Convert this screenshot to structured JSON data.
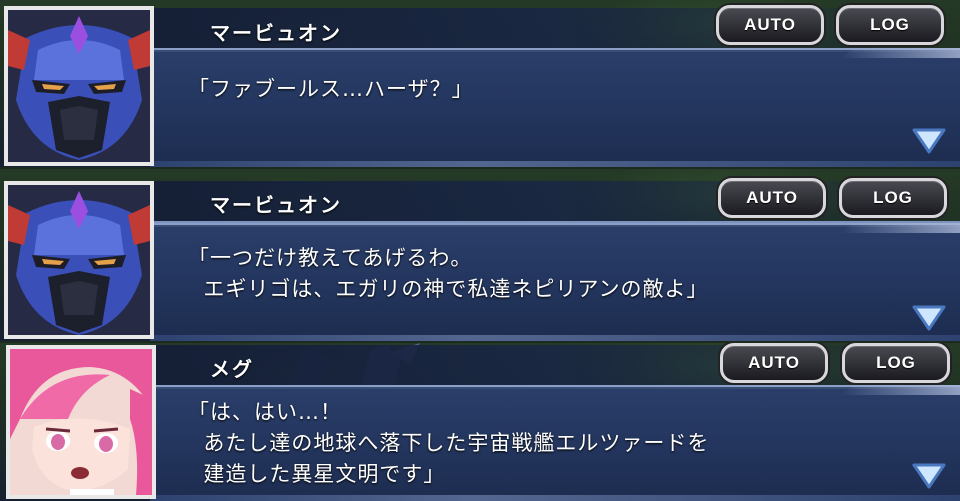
{
  "ui": {
    "auto_label": "AUTO",
    "log_label": "LOG",
    "colors": {
      "dialog_bg": "#23355d",
      "dialog_border": "#8aa0c8",
      "button_border": "#d8d8dc",
      "next_arrow": "#cfe6ff"
    }
  },
  "panels": [
    {
      "speaker": "マービュオン",
      "portrait_icon": "marvuon-robot-portrait",
      "lines": "「ファブールス…ハーザ？」"
    },
    {
      "speaker": "マービュオン",
      "portrait_icon": "marvuon-robot-portrait",
      "lines": "「一つだけ教えてあげるわ。\n  エギリゴは、エガリの神で私達ネピリアンの敵よ」"
    },
    {
      "speaker": "メグ",
      "portrait_icon": "meg-pink-hair-portrait",
      "lines": "「は、はい…！\n  あたし達の地球へ落下した宇宙戦艦エルツァードを\n  建造した異星文明です」"
    }
  ]
}
